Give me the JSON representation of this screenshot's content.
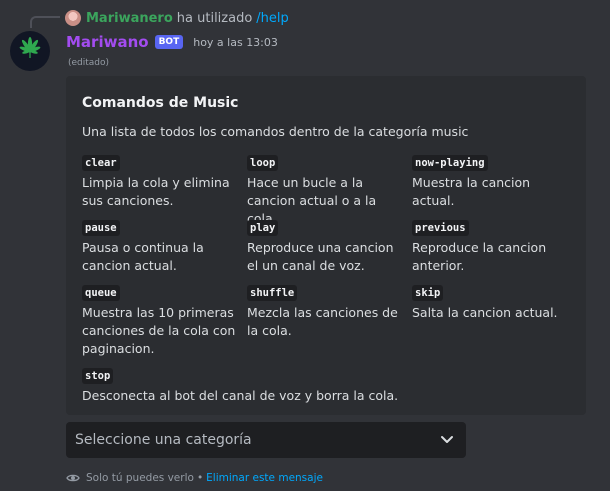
{
  "reply": {
    "username": "Mariwanero",
    "verb": "ha utilizado",
    "command": "/help"
  },
  "message": {
    "author": "Mariwano",
    "tag": "BOT",
    "timestamp": "hoy a las 13:03",
    "edited": "(editado)"
  },
  "embed": {
    "title": "Comandos de Music",
    "description": "Una lista de todos los comandos dentro de la categoría music",
    "fields": [
      {
        "name": "clear",
        "value": "Limpia la cola y elimina sus canciones."
      },
      {
        "name": "loop",
        "value": "Hace un bucle a la cancion actual o a la cola."
      },
      {
        "name": "now-playing",
        "value": "Muestra la cancion actual."
      },
      {
        "name": "pause",
        "value": "Pausa o continua la cancion actual."
      },
      {
        "name": "play",
        "value": "Reproduce una cancion el un canal de voz."
      },
      {
        "name": "previous",
        "value": "Reproduce la cancion anterior."
      },
      {
        "name": "queue",
        "value": "Muestra las 10 primeras canciones de la cola con paginacion."
      },
      {
        "name": "shuffle",
        "value": "Mezcla las canciones de la cola."
      },
      {
        "name": "skip",
        "value": "Salta la cancion actual."
      },
      {
        "name": "stop",
        "value": "Desconecta al bot del canal de voz y borra la cola."
      }
    ]
  },
  "select": {
    "placeholder": "Seleccione una categoría"
  },
  "footer": {
    "note": "Solo tú puedes verlo",
    "separator": "•",
    "dismiss": "Eliminar este mensaje"
  },
  "icons": {
    "avatar": "cannabis-leaf-icon",
    "select_chevron": "chevron-down-icon",
    "footer": "eye-icon"
  },
  "colors": {
    "background": "#313338",
    "embed_background": "#2b2d31",
    "bot_name": "#a34cf0",
    "reply_user": "#3ba55d",
    "link": "#00a8fc",
    "bot_tag": "#5865f2",
    "leaf": "#2fa84f"
  }
}
